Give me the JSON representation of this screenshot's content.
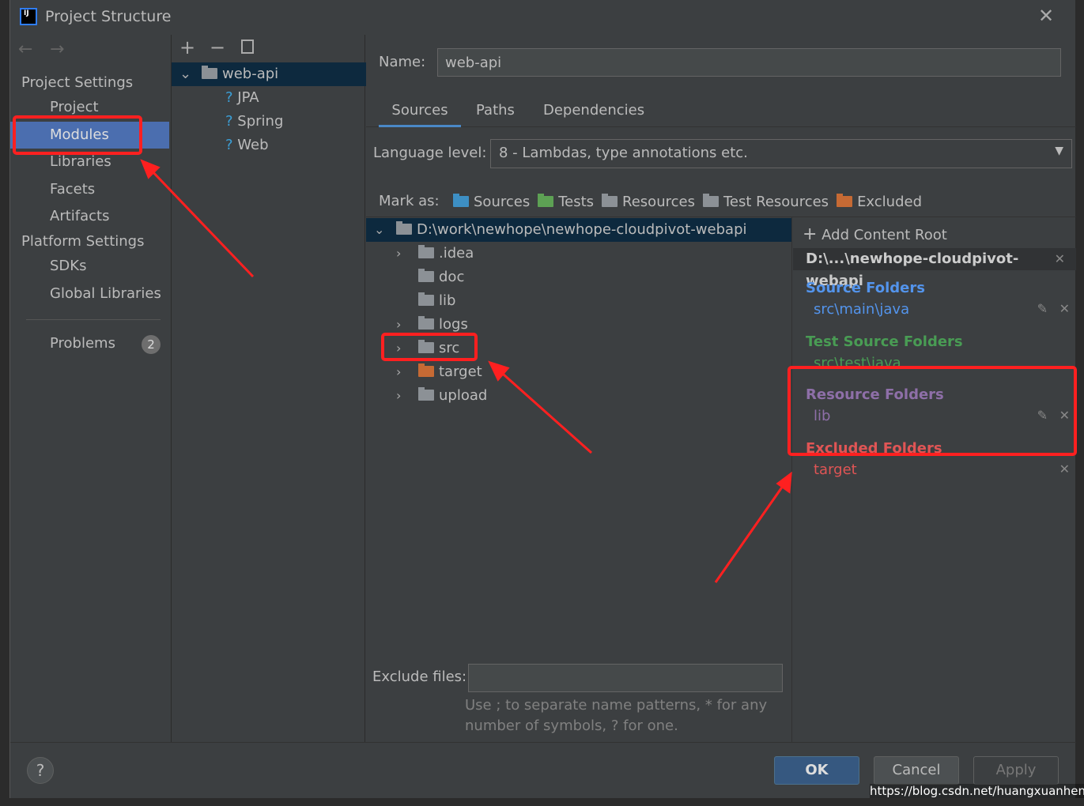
{
  "window": {
    "title": "Project Structure",
    "logo": "IJ"
  },
  "nav": {
    "project_settings": "Project Settings",
    "items": [
      "Project",
      "Modules",
      "Libraries",
      "Facets",
      "Artifacts"
    ],
    "platform_settings": "Platform Settings",
    "platform_items": [
      "SDKs",
      "Global Libraries"
    ],
    "problems": "Problems",
    "problems_count": "2"
  },
  "modules": {
    "root": "web-api",
    "facets": [
      "JPA",
      "Spring",
      "Web"
    ]
  },
  "module": {
    "name_label": "Name:",
    "name_value": "web-api",
    "tabs": [
      "Sources",
      "Paths",
      "Dependencies"
    ],
    "active_tab": "Sources",
    "language_level_label": "Language level:",
    "language_level": "8 - Lambdas, type annotations etc.",
    "mark_as_label": "Mark as:",
    "mark_as": [
      "Sources",
      "Tests",
      "Resources",
      "Test Resources",
      "Excluded"
    ]
  },
  "tree": {
    "root": "D:\\work\\newhope\\newhope-cloudpivot-webapi",
    "children": [
      ".idea",
      "doc",
      "lib",
      "logs",
      "src",
      "target",
      "upload"
    ]
  },
  "content_root": {
    "add": "Add Content Root",
    "path": "D:\\...\\newhope-cloudpivot-webapi",
    "source_title": "Source Folders",
    "source": "src\\main\\java",
    "test_title": "Test Source Folders",
    "test": "src\\test\\java",
    "resource_title": "Resource Folders",
    "resource": "lib",
    "excluded_title": "Excluded Folders",
    "excluded": "target"
  },
  "exclude": {
    "label": "Exclude files:",
    "value": "",
    "hint1": "Use ; to separate name patterns, * for any",
    "hint2": "number of symbols, ? for one."
  },
  "buttons": {
    "ok": "OK",
    "cancel": "Cancel",
    "apply": "Apply",
    "help": "?"
  },
  "watermark": "https://blog.csdn.net/huangxuanheng",
  "colors": {
    "selection": "#4b6eaf",
    "source": "#5394ec",
    "test": "#499c54",
    "resource": "#8e6fa8",
    "excluded": "#e05555",
    "annotation": "#ff2020"
  }
}
